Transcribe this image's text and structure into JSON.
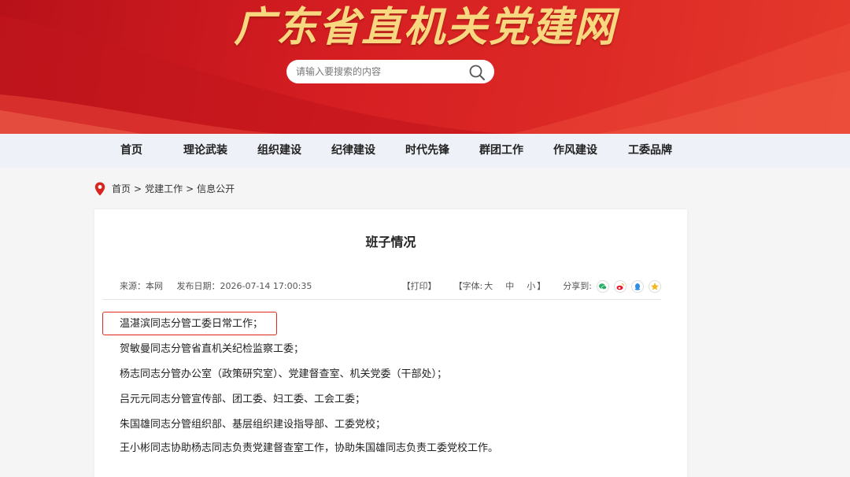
{
  "header": {
    "site_title": "广东省直机关党建网",
    "search_placeholder": "请输入要搜索的内容",
    "search_value": ""
  },
  "nav": {
    "items": [
      "首页",
      "理论武装",
      "组织建设",
      "纪律建设",
      "时代先锋",
      "群团工作",
      "作风建设",
      "工委品牌"
    ]
  },
  "breadcrumb": {
    "items": [
      "首页",
      "党建工作",
      "信息公开"
    ],
    "separator": ">"
  },
  "article": {
    "title": "班子情况",
    "meta": {
      "source": "来源：本网",
      "date": "发布日期：2026-07-14 17:00:35",
      "print": "【打印】",
      "font_prefix": "【字体:",
      "font_large": "大",
      "font_medium": "中",
      "font_small": "小",
      "font_suffix": "】",
      "share_label": "分享到:"
    },
    "paragraphs": [
      "温湛滨同志分管工委日常工作；",
      "贺敏曼同志分管省直机关纪检监察工委；",
      "杨志同志分管办公室（政策研究室）、党建督查室、机关党委（干部处）；",
      "吕元元同志分管宣传部、团工委、妇工委、工会工委；",
      "朱国雄同志分管组织部、基层组织建设指导部、工委党校；",
      "王小彬同志协助杨志同志负责党建督查室工作，协助朱国雄同志负责工委党校工作。"
    ]
  },
  "colors": {
    "banner_red": "#d51e22",
    "title_gold": "#f7d77f",
    "nav_bg": "#eef1f7",
    "highlight": "#e0281e",
    "wechat": "#2aae67",
    "weibo": "#e6162d",
    "qq": "#2f8ee8",
    "qzone": "#f5b81e"
  }
}
